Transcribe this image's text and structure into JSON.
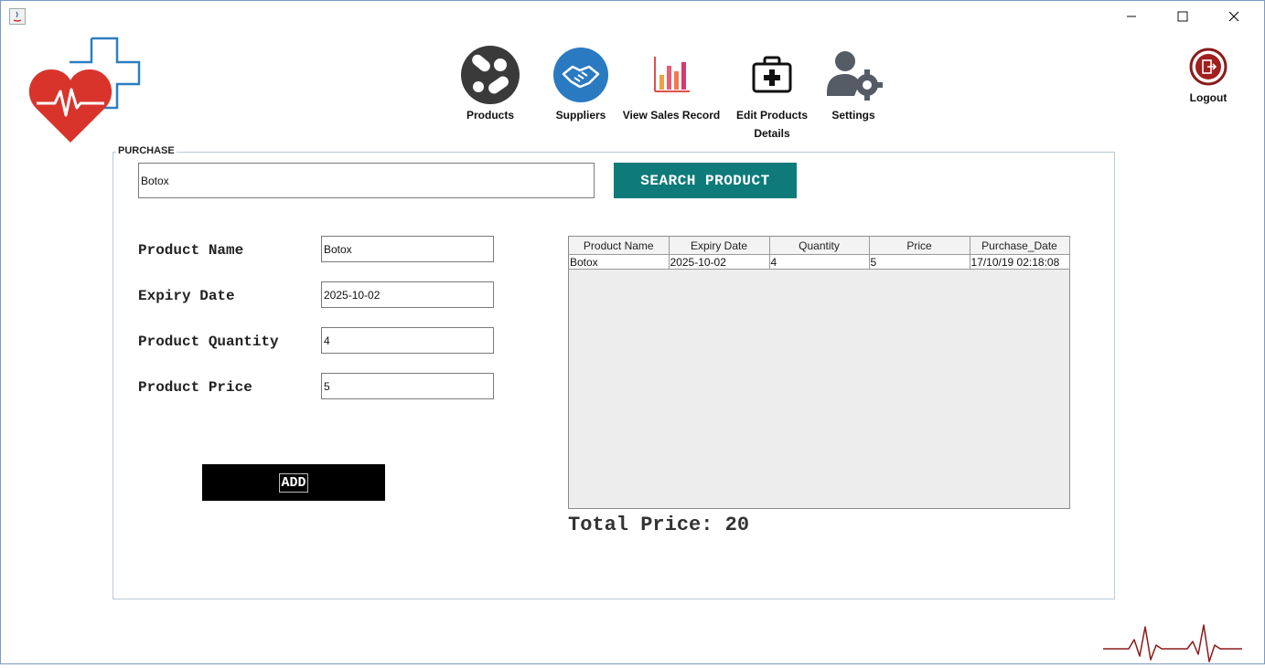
{
  "window": {
    "minimize_icon": "minimize-icon",
    "maximize_icon": "maximize-icon",
    "close_icon": "close-icon"
  },
  "nav": {
    "items": [
      {
        "label": "Products",
        "icon": "pills-icon"
      },
      {
        "label": "Suppliers",
        "icon": "handshake-icon"
      },
      {
        "label": "View Sales Record",
        "icon": "bar-chart-icon"
      },
      {
        "label": "Edit Products Details",
        "icon": "first-aid-kit-icon"
      },
      {
        "label": "Settings",
        "icon": "user-gear-icon"
      }
    ],
    "logout_label": "Logout"
  },
  "purchase": {
    "legend": "PURCHASE",
    "search_value": "Botox",
    "search_button": "SEARCH PRODUCT",
    "fields": [
      {
        "label": "Product Name",
        "value": "Botox"
      },
      {
        "label": "Expiry Date",
        "value": "2025-10-02"
      },
      {
        "label": "Product Quantity",
        "value": "4"
      },
      {
        "label": "Product Price",
        "value": "5"
      }
    ],
    "add_button": "ADD",
    "table": {
      "columns": [
        "Product Name",
        "Expiry Date",
        "Quantity",
        "Price",
        "Purchase_Date"
      ],
      "rows": [
        [
          "Botox",
          "2025-10-02",
          "4",
          "5",
          "17/10/19 02:18:08"
        ]
      ]
    },
    "total_label": "Total Price: 20"
  },
  "colors": {
    "search_button": "#0e7a7a",
    "add_button": "#000000",
    "logout_ring": "#8b1a1a",
    "heart": "#d9342b",
    "cross": "#2c7fc0"
  }
}
